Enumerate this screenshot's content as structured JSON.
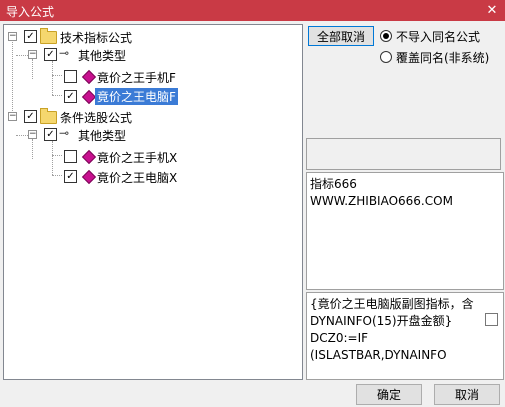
{
  "window": {
    "title": "导入公式",
    "close_glyph": "✕"
  },
  "tree": {
    "nodes": [
      {
        "label": "技术指标公式"
      },
      {
        "label": "其他类型"
      },
      {
        "label": "竟价之王手机F"
      },
      {
        "label": "竟价之王电脑F",
        "selected": true
      },
      {
        "label": "条件选股公式"
      },
      {
        "label": "其他类型"
      },
      {
        "label": "竟价之王手机X"
      },
      {
        "label": "竟价之王电脑X"
      }
    ]
  },
  "buttons": {
    "deselect_all": "全部取消",
    "ok": "确定",
    "cancel": "取消"
  },
  "radios": [
    {
      "label": "不导入同名公式",
      "checked": true
    },
    {
      "label": "覆盖同名(非系统)",
      "checked": false
    }
  ],
  "info_panel": {
    "line1": "指标666",
    "line2": "WWW.ZHIBIAO666.COM"
  },
  "formula_panel": {
    "line1": "{竟价之王电脑版副图指标，含",
    "line2": "DYNAINFO(15)开盘金额}",
    "line3": "DCZ0:=IF",
    "line4": "(ISLASTBAR,DYNAINFO"
  }
}
